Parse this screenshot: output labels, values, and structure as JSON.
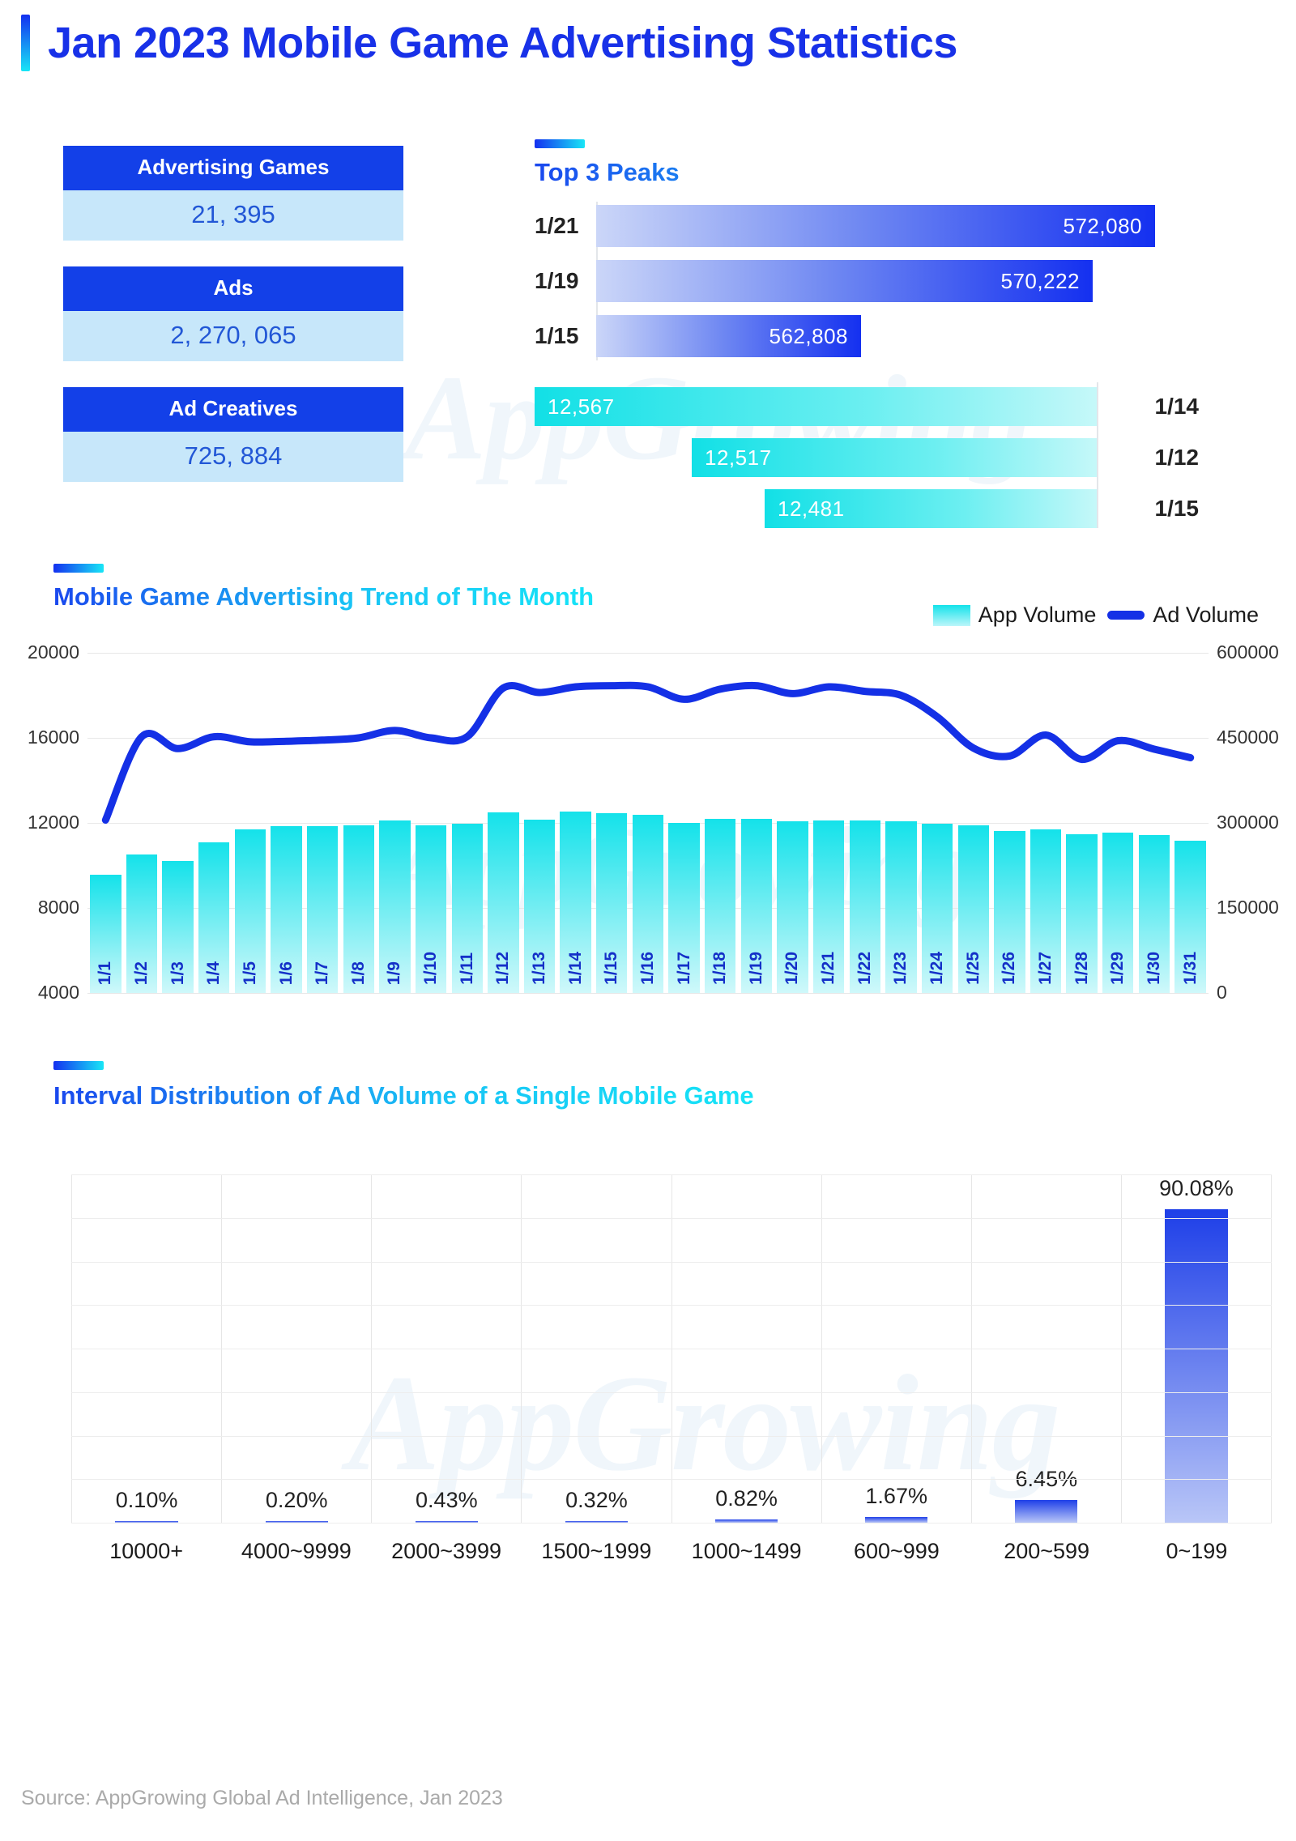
{
  "title": "Jan 2023 Mobile Game Advertising Statistics",
  "kpis": [
    {
      "label": "Advertising Games",
      "value": "21, 395"
    },
    {
      "label": "Ads",
      "value": "2, 270, 065"
    },
    {
      "label": "Ad Creatives",
      "value": "725, 884"
    }
  ],
  "peaks": {
    "title": "Top 3 Peaks",
    "ad_rows": [
      {
        "date": "1/21",
        "value": "572,080",
        "num": 572080
      },
      {
        "date": "1/19",
        "value": "570,222",
        "num": 570222
      },
      {
        "date": "1/15",
        "value": "562,808",
        "num": 562808
      }
    ],
    "app_rows": [
      {
        "date": "1/14",
        "value": "12,567",
        "num": 12567
      },
      {
        "date": "1/12",
        "value": "12,517",
        "num": 12517
      },
      {
        "date": "1/15",
        "value": "12,481",
        "num": 12481
      }
    ]
  },
  "trend": {
    "title": "Mobile Game Advertising Trend of The Month",
    "legend": [
      {
        "name": "App Volume",
        "type": "bar",
        "color": "#14E2EA"
      },
      {
        "name": "Ad Volume",
        "type": "line",
        "color": "#1430E6"
      }
    ]
  },
  "dist": {
    "title": "Interval Distribution of Ad Volume of a Single Mobile Game"
  },
  "watermark": "AppGrowing",
  "footer": "Source: AppGrowing Global Ad Intelligence, Jan 2023",
  "colors": {
    "brand_blue": "#1430F0",
    "brand_cyan": "#16E4F7",
    "kpi_header": "#1340E8",
    "kpi_value_bg": "#C7E7FA",
    "kpi_value_text": "#2257D6"
  },
  "chart_data": [
    {
      "type": "bar",
      "title": "Top 3 Peaks - Ad Volume",
      "categories": [
        "1/21",
        "1/19",
        "1/15"
      ],
      "values": [
        572080,
        570222,
        562808
      ],
      "xlabel": "",
      "ylabel": "Ad Volume"
    },
    {
      "type": "bar",
      "title": "Top 3 Peaks - App Volume",
      "categories": [
        "1/14",
        "1/12",
        "1/15"
      ],
      "values": [
        12567,
        12517,
        12481
      ],
      "xlabel": "",
      "ylabel": "App Volume"
    },
    {
      "type": "bar",
      "title": "Mobile Game Advertising Trend of The Month",
      "categories": [
        "1/1",
        "1/2",
        "1/3",
        "1/4",
        "1/5",
        "1/6",
        "1/7",
        "1/8",
        "1/9",
        "1/10",
        "1/11",
        "1/12",
        "1/13",
        "1/14",
        "1/15",
        "1/16",
        "1/17",
        "1/18",
        "1/19",
        "1/20",
        "1/21",
        "1/22",
        "1/23",
        "1/24",
        "1/25",
        "1/26",
        "1/27",
        "1/28",
        "1/29",
        "1/30",
        "1/31"
      ],
      "series": [
        {
          "name": "App Volume",
          "type": "bar",
          "axis": "left",
          "values": [
            9550,
            10500,
            10220,
            11100,
            11680,
            11830,
            11840,
            11880,
            12130,
            11900,
            11960,
            12480,
            12150,
            12520,
            12440,
            12380,
            12010,
            12180,
            12200,
            12060,
            12110,
            12100,
            12080,
            11950,
            11870,
            11630,
            11700,
            11460,
            11550,
            11430,
            11150
          ]
        },
        {
          "name": "Ad Volume",
          "type": "line",
          "axis": "right",
          "values": [
            305000,
            452000,
            431000,
            452000,
            443000,
            444000,
            446000,
            450000,
            463000,
            450000,
            452000,
            538000,
            530000,
            540000,
            542000,
            540000,
            518000,
            536000,
            542000,
            528000,
            540000,
            532000,
            525000,
            487000,
            432000,
            418000,
            455000,
            412000,
            445000,
            430000,
            415000
          ]
        }
      ],
      "ylim_left": [
        4000,
        20000
      ],
      "ylim_right": [
        0,
        600000
      ],
      "yticks_left": [
        "20000",
        "16000",
        "12000",
        "8000",
        "4000"
      ],
      "yticks_right": [
        "600000",
        "450000",
        "300000",
        "150000",
        "0"
      ],
      "grid": true,
      "legend_position": "top-right"
    },
    {
      "type": "bar",
      "title": "Interval Distribution of Ad Volume of a Single Mobile Game",
      "categories": [
        "10000+",
        "4000~9999",
        "2000~3999",
        "1500~1999",
        "1000~1499",
        "600~999",
        "200~599",
        "0~199"
      ],
      "values": [
        0.1,
        0.2,
        0.43,
        0.32,
        0.82,
        1.67,
        6.45,
        90.08
      ],
      "value_labels": [
        "0.10%",
        "0.20%",
        "0.43%",
        "0.32%",
        "0.82%",
        "1.67%",
        "6.45%",
        "90.08%"
      ],
      "ylim": [
        0,
        100
      ],
      "xlabel": "",
      "ylabel": "",
      "grid": true
    }
  ]
}
